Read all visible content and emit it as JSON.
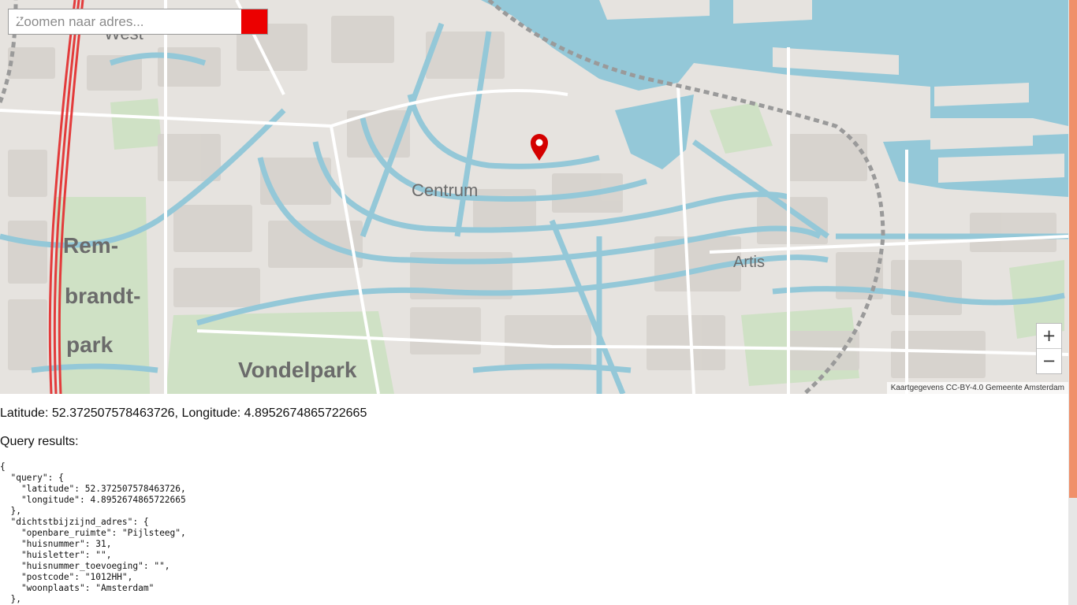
{
  "search": {
    "placeholder": "Zoomen naar adres..."
  },
  "map": {
    "labels": {
      "west": "West",
      "centrum": "Centrum",
      "artis": "Artis",
      "rem": "Rem-",
      "brandt": "brandt-",
      "park": "park",
      "vondelpark": "Vondelpark"
    },
    "attribution": "Kaartgegevens CC-BY-4.0 Gemeente Amsterdam",
    "zoom_in": "+",
    "zoom_out": "−",
    "colors": {
      "water": "#94c8d8",
      "land": "#e6e3df",
      "park": "#cfe1c5",
      "block": "#d8d4cf",
      "marker": "#d40000"
    }
  },
  "coords_text": "Latitude: 52.372507578463726, Longitude: 4.8952674865722665",
  "query_label": "Query results:",
  "json_text": "{\n  \"query\": {\n    \"latitude\": 52.372507578463726,\n    \"longitude\": 4.8952674865722665\n  },\n  \"dichtstbijzijnd_adres\": {\n    \"openbare_ruimte\": \"Pijlsteeg\",\n    \"huisnummer\": 31,\n    \"huisletter\": \"\",\n    \"huisnummer_toevoeging\": \"\",\n    \"postcode\": \"1012HH\",\n    \"woonplaats\": \"Amsterdam\"\n  },"
}
